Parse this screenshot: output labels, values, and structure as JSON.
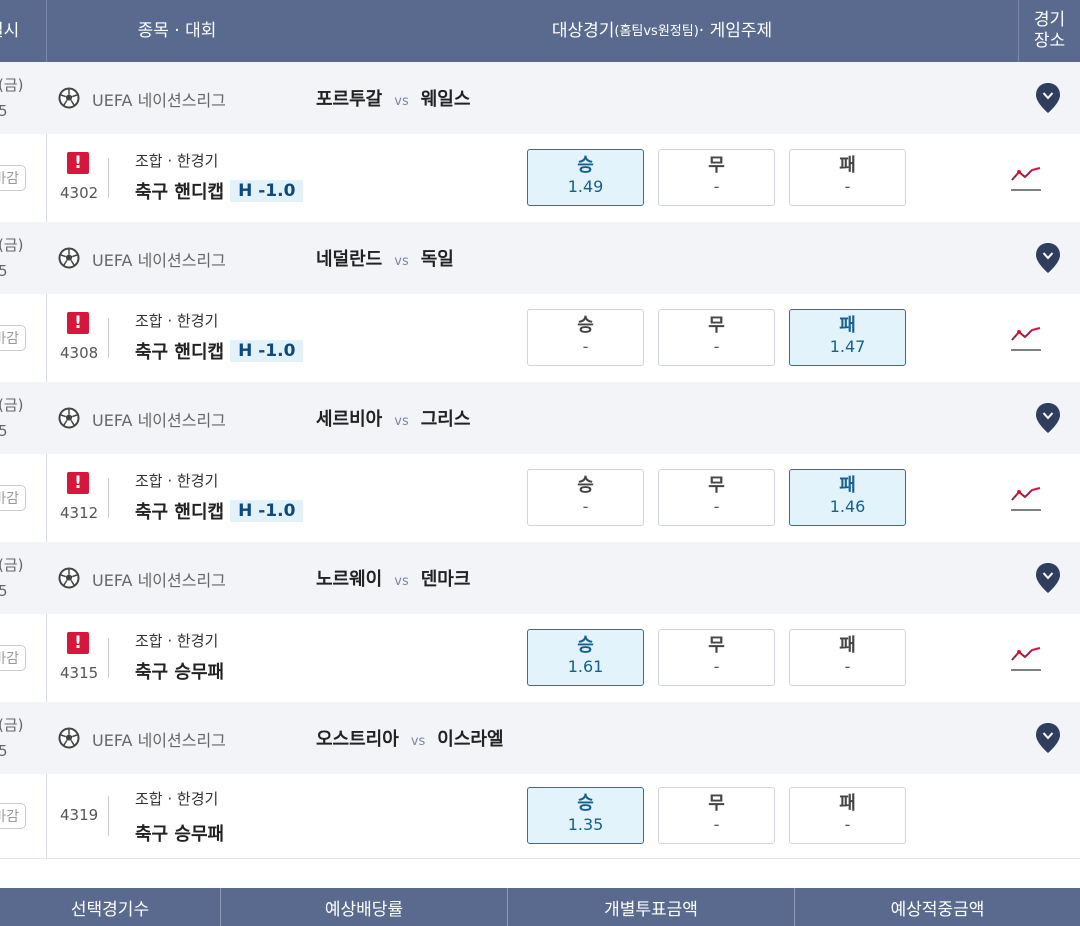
{
  "header": {
    "col_datetime": "일시",
    "col_sport": "종목 · 대회",
    "col_match_main": "대상경기",
    "col_match_small": "(홈팀vs원정팀)",
    "col_match_tail": " · 게임주제",
    "col_venue_1": "경기",
    "col_venue_2": "장소"
  },
  "games": [
    {
      "date": "(금)",
      "time": "5",
      "league": "UEFA 네이션스리그",
      "home": "포르투갈",
      "vs": "vs",
      "away": "웨일스",
      "deadline": "마감",
      "alert": "!",
      "number": "4302",
      "type": "조합 · 한경기",
      "game_name": "축구 핸디캡",
      "handicap": "H -1.0",
      "odds": [
        {
          "label": "승",
          "value": "1.49",
          "selected": true
        },
        {
          "label": "무",
          "value": "-",
          "selected": false
        },
        {
          "label": "패",
          "value": "-",
          "selected": false
        }
      ]
    },
    {
      "date": "(금)",
      "time": "5",
      "league": "UEFA 네이션스리그",
      "home": "네덜란드",
      "vs": "vs",
      "away": "독일",
      "deadline": "마감",
      "alert": "!",
      "number": "4308",
      "type": "조합 · 한경기",
      "game_name": "축구 핸디캡",
      "handicap": "H -1.0",
      "odds": [
        {
          "label": "승",
          "value": "-",
          "selected": false
        },
        {
          "label": "무",
          "value": "-",
          "selected": false
        },
        {
          "label": "패",
          "value": "1.47",
          "selected": true
        }
      ]
    },
    {
      "date": "(금)",
      "time": "5",
      "league": "UEFA 네이션스리그",
      "home": "세르비아",
      "vs": "vs",
      "away": "그리스",
      "deadline": "마감",
      "alert": "!",
      "number": "4312",
      "type": "조합 · 한경기",
      "game_name": "축구 핸디캡",
      "handicap": "H -1.0",
      "odds": [
        {
          "label": "승",
          "value": "-",
          "selected": false
        },
        {
          "label": "무",
          "value": "-",
          "selected": false
        },
        {
          "label": "패",
          "value": "1.46",
          "selected": true
        }
      ]
    },
    {
      "date": "(금)",
      "time": "5",
      "league": "UEFA 네이션스리그",
      "home": "노르웨이",
      "vs": "vs",
      "away": "덴마크",
      "deadline": "마감",
      "alert": "!",
      "number": "4315",
      "type": "조합 · 한경기",
      "game_name": "축구 승무패",
      "handicap": "",
      "odds": [
        {
          "label": "승",
          "value": "1.61",
          "selected": true
        },
        {
          "label": "무",
          "value": "-",
          "selected": false
        },
        {
          "label": "패",
          "value": "-",
          "selected": false
        }
      ]
    },
    {
      "date": "(금)",
      "time": "5",
      "league": "UEFA 네이션스리그",
      "home": "오스트리아",
      "vs": "vs",
      "away": "이스라엘",
      "deadline": "마감",
      "alert": "",
      "number": "4319",
      "type": "조합 · 한경기",
      "game_name": "축구 승무패",
      "handicap": "",
      "odds": [
        {
          "label": "승",
          "value": "1.35",
          "selected": true
        },
        {
          "label": "무",
          "value": "-",
          "selected": false
        },
        {
          "label": "패",
          "value": "-",
          "selected": false
        }
      ]
    }
  ],
  "footer": {
    "selected_count": "선택경기수",
    "expected_odds": "예상배당률",
    "bet_amount": "개별투표금액",
    "expected_win": "예상적중금액"
  },
  "colors": {
    "header_bg": "#5a6a8f",
    "selected_bg": "#e3f3fc",
    "alert": "#d6163a",
    "pin": "#2f3e5c"
  }
}
